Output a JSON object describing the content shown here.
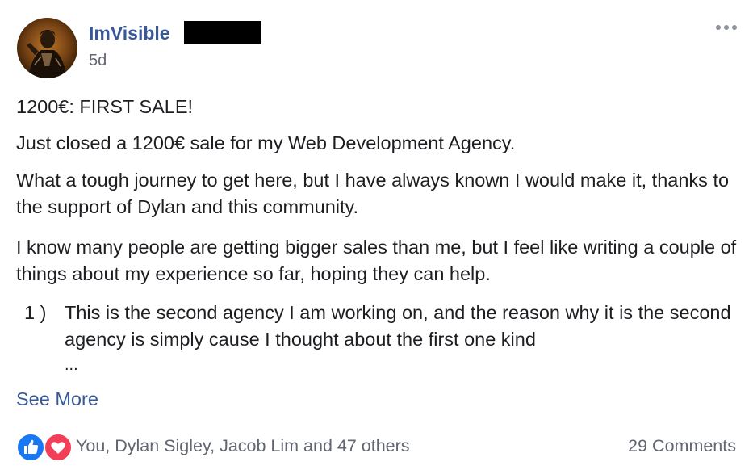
{
  "post": {
    "author": "ImVisible",
    "timestamp": "5d",
    "paragraphs": [
      "1200€: FIRST SALE!",
      "Just closed a 1200€ sale for my Web Development Agency.",
      "What a tough journey to get here, but I have always known I would make it, thanks to the support of Dylan and this community.",
      "I know many people are getting bigger sales than me, but I feel like writing a couple of things about my experience so far, hoping they can help."
    ],
    "list": [
      {
        "number": "1 )",
        "text": "This is the second agency I am working on, and the reason why it is the second agency is simply cause I thought about the first one kind"
      }
    ],
    "truncation": "...",
    "see_more_label": "See More"
  },
  "footer": {
    "reaction_icons": [
      "like-icon",
      "love-icon"
    ],
    "reactions_summary": "You, Dylan Sigley, Jacob Lim and 47 others",
    "comments_count": "29 Comments"
  },
  "colors": {
    "link": "#385898",
    "meta_text": "#616770",
    "body_text": "#1c1e21",
    "like_blue": "#1877f2",
    "love_red": "#f33e58"
  }
}
